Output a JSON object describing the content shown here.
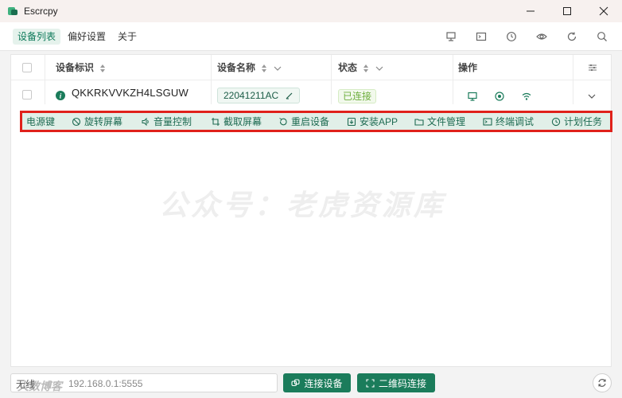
{
  "window": {
    "title": "Escrcpy"
  },
  "menu": {
    "items": [
      "设备列表",
      "偏好设置",
      "关于"
    ],
    "active_index": 0
  },
  "table": {
    "headers": {
      "serial": "设备标识",
      "name": "设备名称",
      "status": "状态",
      "operations": "操作"
    },
    "rows": [
      {
        "serial": "QKKRKVVKZH4LSGUW",
        "name": "22041211AC",
        "status": "已连接"
      }
    ]
  },
  "actions": [
    "电源键",
    "旋转屏幕",
    "音量控制",
    "截取屏幕",
    "重启设备",
    "安装APP",
    "文件管理",
    "终端调试",
    "计划任务"
  ],
  "watermark": "公众号：老虎资源库",
  "footer": {
    "input_prefix": "无线",
    "input_value": "192.168.0.1:5555",
    "connect_label": "连接设备",
    "qr_label": "二维码连接",
    "corner_watermark": "火数博客"
  },
  "colors": {
    "accent": "#1b7c5b",
    "highlight_border": "#e0211b",
    "status_ok": "#6dae3d"
  }
}
